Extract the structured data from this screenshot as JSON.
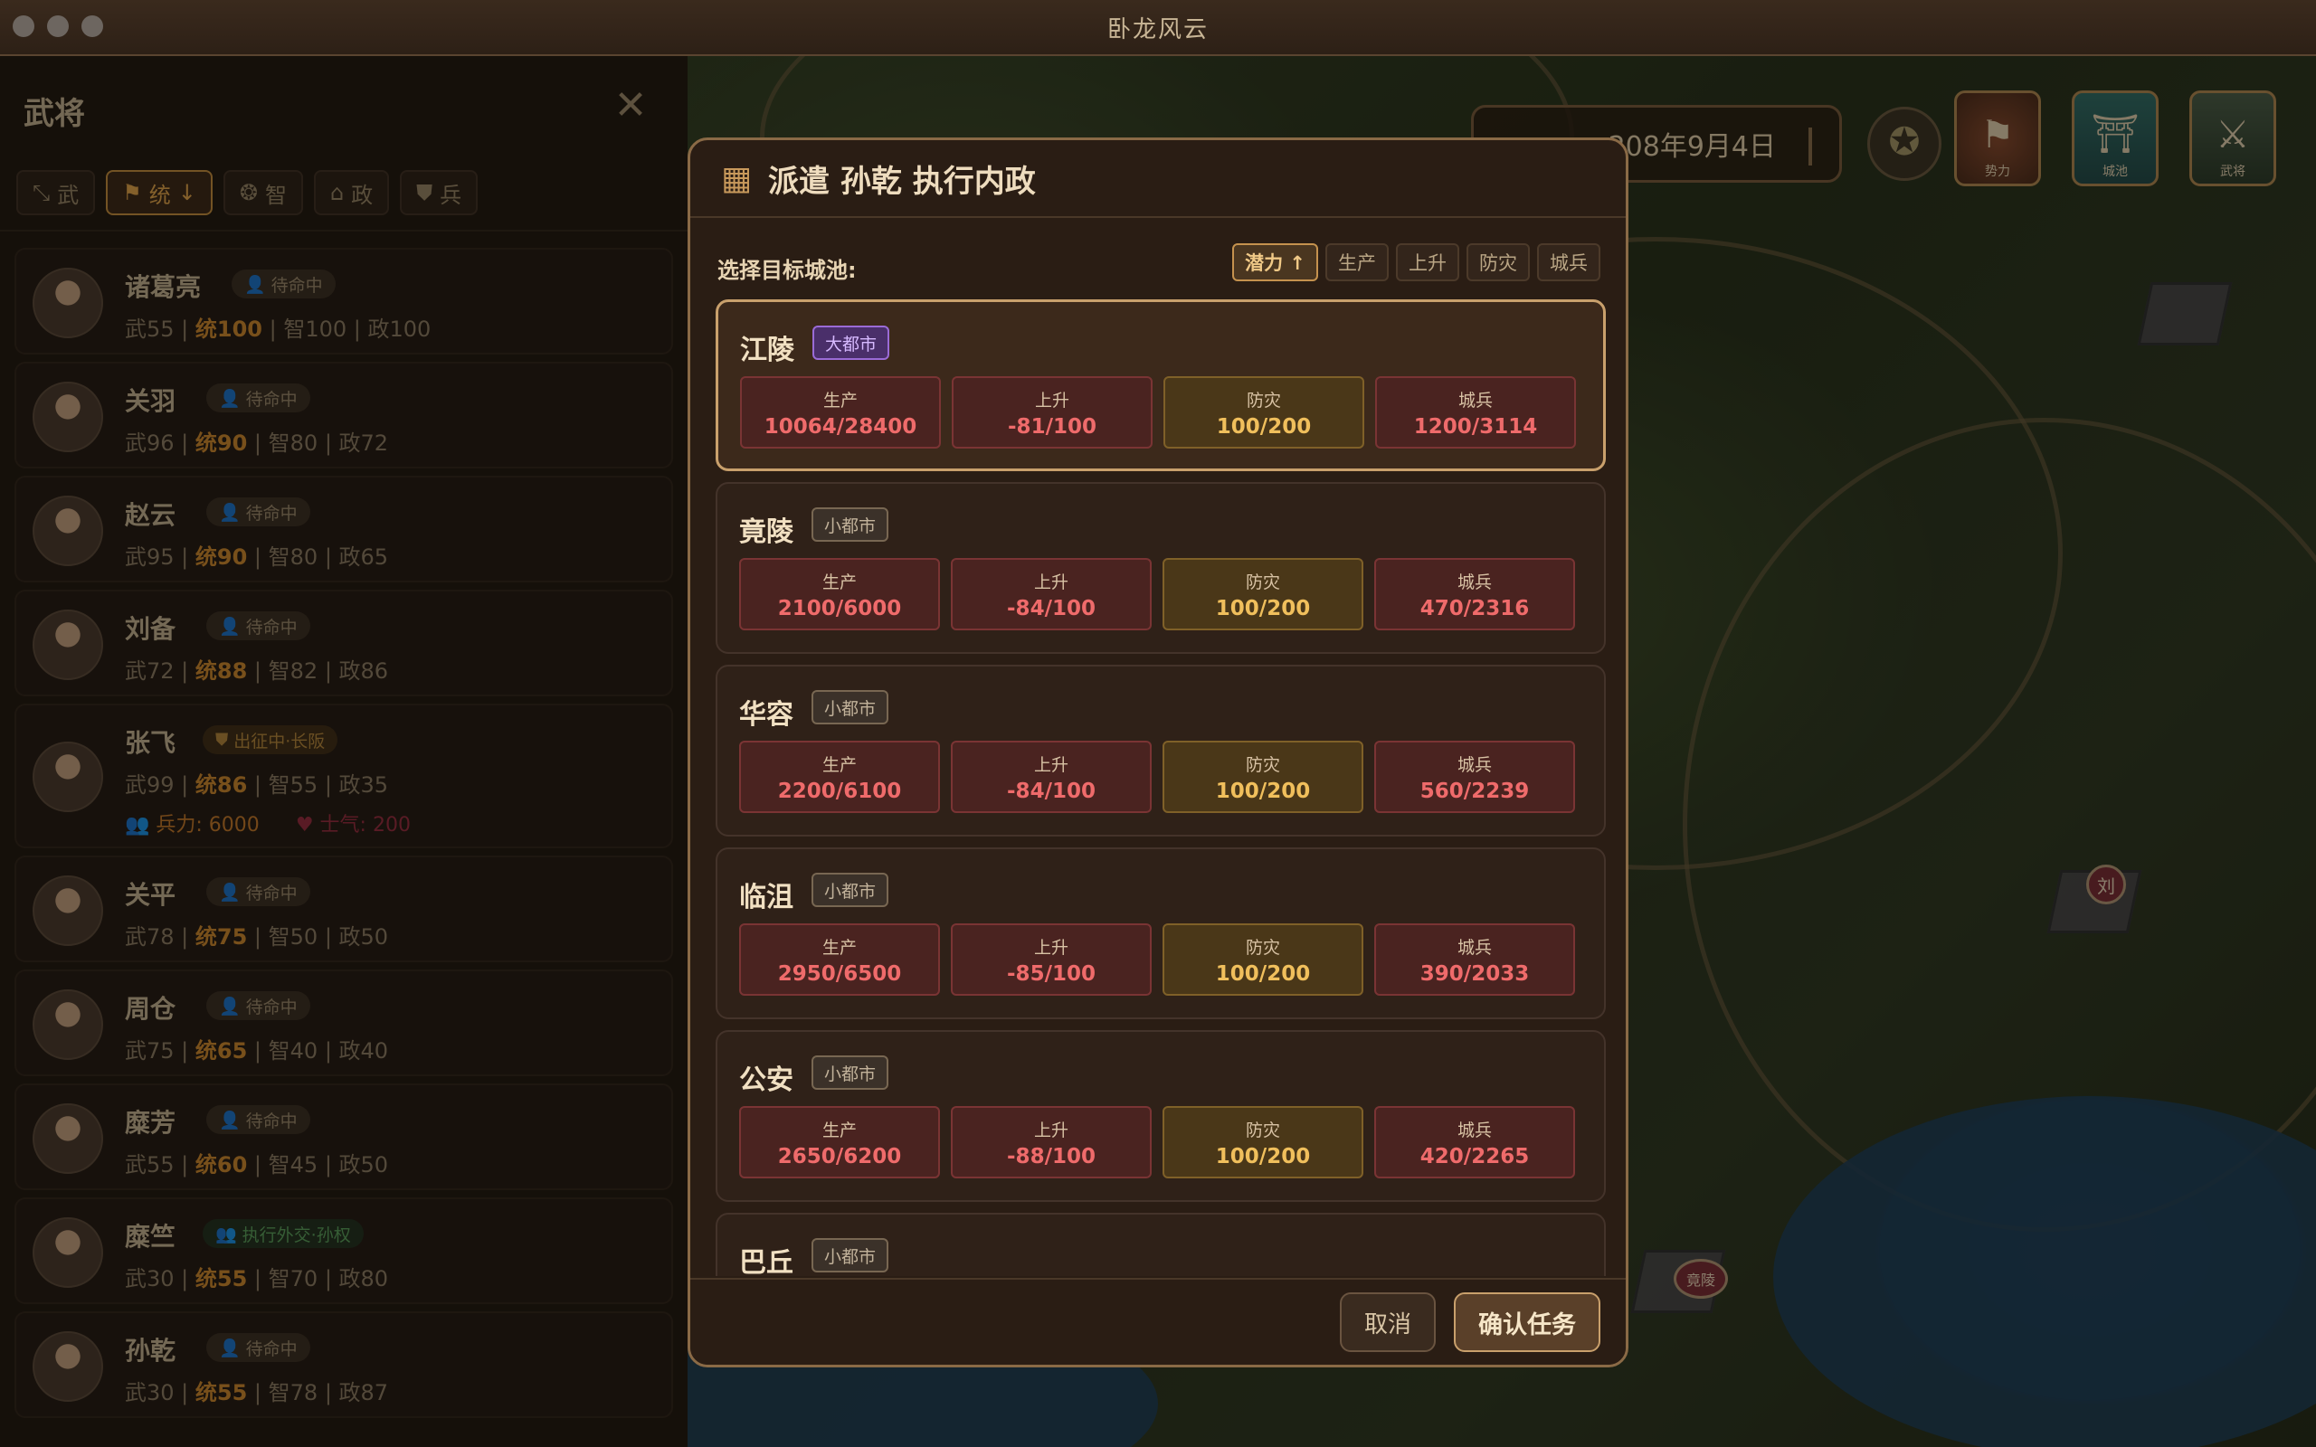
{
  "window": {
    "title": "卧龙风云"
  },
  "hud": {
    "date": "208年9月4日",
    "icons": [
      {
        "name": "faction-icon",
        "label": "势力"
      },
      {
        "name": "city-icon",
        "label": "城池"
      },
      {
        "name": "general-icon",
        "label": "武将"
      }
    ],
    "map_markers": [
      "刘",
      "竟陵"
    ]
  },
  "left_panel": {
    "title": "武将",
    "sort_buttons": [
      {
        "label": "武",
        "icon": "sword-icon"
      },
      {
        "label": "统",
        "icon": "banner-icon",
        "active": true
      },
      {
        "label": "智",
        "icon": "brain-icon"
      },
      {
        "label": "政",
        "icon": "building-icon"
      },
      {
        "label": "兵",
        "icon": "shield-icon"
      }
    ],
    "generals": [
      {
        "name": "诸葛亮",
        "status": "待命中",
        "wu": "武55",
        "tong": "统100",
        "zhi": "智100",
        "zheng": "政100"
      },
      {
        "name": "关羽",
        "status": "待命中",
        "wu": "武96",
        "tong": "统90",
        "zhi": "智80",
        "zheng": "政72"
      },
      {
        "name": "赵云",
        "status": "待命中",
        "wu": "武95",
        "tong": "统90",
        "zhi": "智80",
        "zheng": "政65"
      },
      {
        "name": "刘备",
        "status": "待命中",
        "wu": "武72",
        "tong": "统88",
        "zhi": "智82",
        "zheng": "政86"
      },
      {
        "name": "张飞",
        "status": "出征中·长阪",
        "wu": "武99",
        "tong": "统86",
        "zhi": "智55",
        "zheng": "政35",
        "troops": "兵力: 6000",
        "morale": "士气: 200"
      },
      {
        "name": "关平",
        "status": "待命中",
        "wu": "武78",
        "tong": "统75",
        "zhi": "智50",
        "zheng": "政50"
      },
      {
        "name": "周仓",
        "status": "待命中",
        "wu": "武75",
        "tong": "统65",
        "zhi": "智40",
        "zheng": "政40"
      },
      {
        "name": "糜芳",
        "status": "待命中",
        "wu": "武55",
        "tong": "统60",
        "zhi": "智45",
        "zheng": "政50"
      },
      {
        "name": "糜竺",
        "status": "执行外交·孙权",
        "wu": "武30",
        "tong": "统55",
        "zhi": "智70",
        "zheng": "政80"
      },
      {
        "name": "孙乾",
        "status": "待命中",
        "wu": "武30",
        "tong": "统55",
        "zhi": "智78",
        "zheng": "政87"
      }
    ]
  },
  "modal": {
    "title": "派遣 孙乾 执行内政",
    "select_label": "选择目标城池:",
    "filters": [
      {
        "label": "潜力 ↑",
        "active": true
      },
      {
        "label": "生产"
      },
      {
        "label": "上升"
      },
      {
        "label": "防灾"
      },
      {
        "label": "城兵"
      }
    ],
    "stat_labels": {
      "prod": "生产",
      "rise": "上升",
      "disaster": "防灾",
      "troops": "城兵"
    },
    "cities": [
      {
        "name": "江陵",
        "tag": "大都市",
        "prod": "10064/28400",
        "rise": "-81/100",
        "disaster": "100/200",
        "troops": "1200/3114"
      },
      {
        "name": "竟陵",
        "tag": "小都市",
        "prod": "2100/6000",
        "rise": "-84/100",
        "disaster": "100/200",
        "troops": "470/2316"
      },
      {
        "name": "华容",
        "tag": "小都市",
        "prod": "2200/6100",
        "rise": "-84/100",
        "disaster": "100/200",
        "troops": "560/2239"
      },
      {
        "name": "临沮",
        "tag": "小都市",
        "prod": "2950/6500",
        "rise": "-85/100",
        "disaster": "100/200",
        "troops": "390/2033"
      },
      {
        "name": "公安",
        "tag": "小都市",
        "prod": "2650/6200",
        "rise": "-88/100",
        "disaster": "100/200",
        "troops": "420/2265"
      },
      {
        "name": "巴丘",
        "tag": "小都市"
      }
    ],
    "cancel_label": "取消",
    "confirm_label": "确认任务"
  }
}
